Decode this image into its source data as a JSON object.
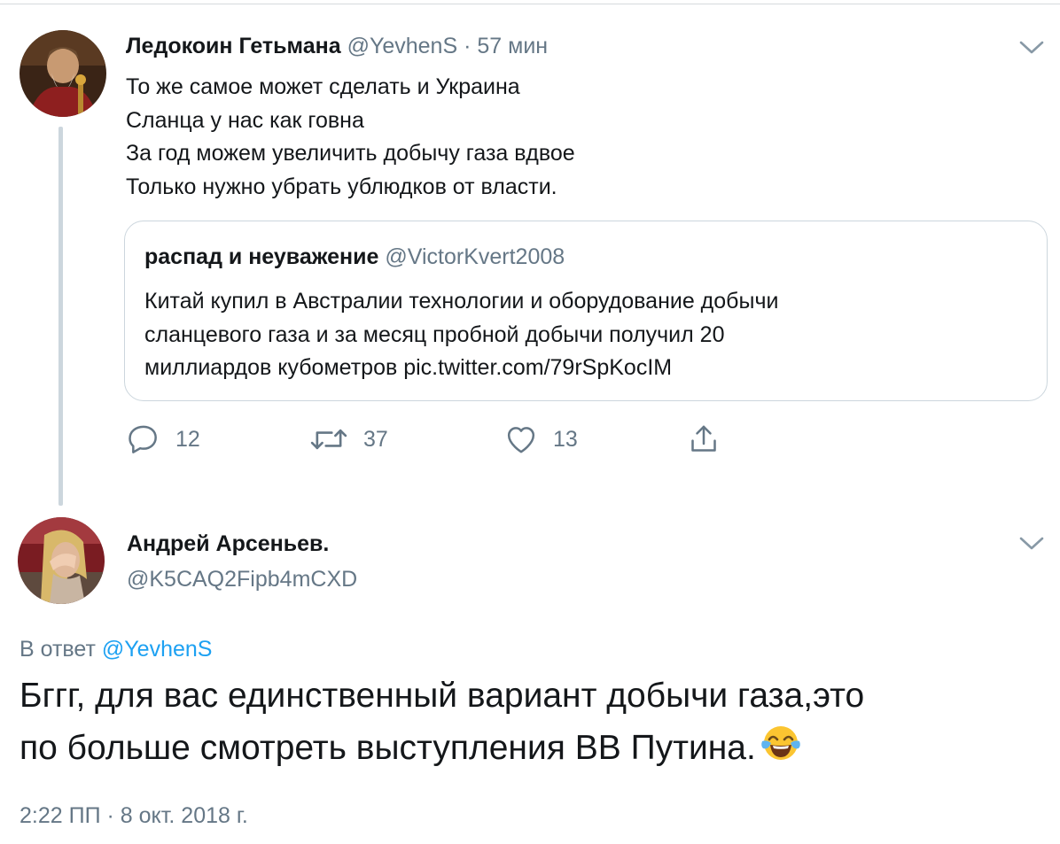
{
  "tweet": {
    "author_name": "Ледокоин Гетьмана",
    "author_handle": "@YevhenS",
    "separator": "·",
    "time_ago": "57 мин",
    "lines": [
      "То же самое может сделать и Украина",
      "Сланца у нас как говна",
      "За год можем увеличить добычу газа вдвое",
      "Только нужно убрать ублюдков от власти."
    ],
    "quoted": {
      "author_name": "распад и неуважение",
      "author_handle": "@VictorKvert2008",
      "lines": [
        "Китай купил в Австралии технологии и оборудование добычи",
        "сланцевого газа и за месяц пробной добычи получил 20",
        "миллиардов кубометров pic.twitter.com/79rSpKocIM"
      ]
    },
    "actions": {
      "replies": "12",
      "retweets": "37",
      "likes": "13"
    }
  },
  "reply": {
    "author_name": "Андрей Арсеньев.",
    "author_handle": "@K5CAQ2Fipb4mCXD",
    "reply_prefix": "В ответ",
    "reply_to": "@YevhenS",
    "lines": [
      "Бггг, для вас единственный вариант добычи газа,это",
      "по больше смотреть выступления  ВВ Путина."
    ],
    "emoji": "face-with-tears-of-joy",
    "timestamp": "2:22 ПП · 8 окт. 2018 г."
  },
  "colors": {
    "text": "#14171a",
    "muted": "#657786",
    "link": "#1da1f2",
    "border": "#ccd6dd"
  }
}
